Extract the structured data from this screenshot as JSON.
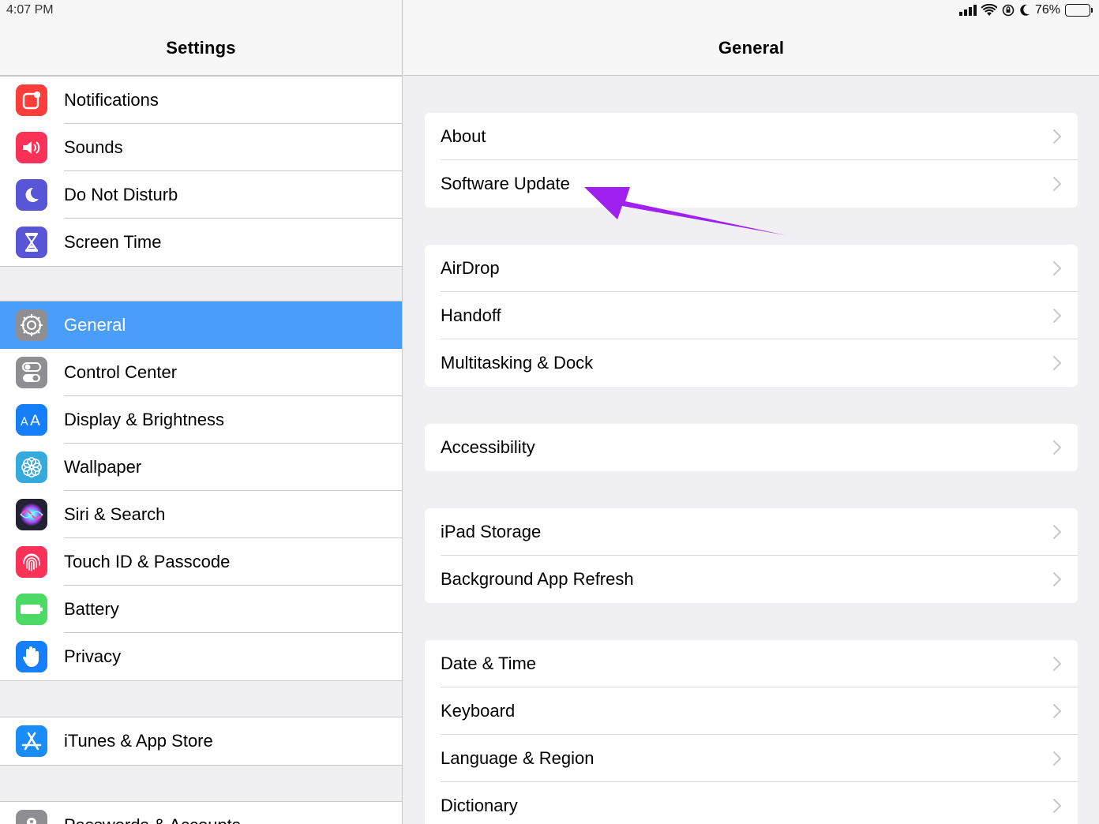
{
  "status_bar": {
    "time": "4:07 PM",
    "battery_percent": "76%",
    "battery_level": 0.76
  },
  "sidebar": {
    "title": "Settings",
    "groups": [
      {
        "items": [
          {
            "label": "Notifications",
            "icon": "notifications-icon",
            "color": "#fc3d39"
          },
          {
            "label": "Sounds",
            "icon": "speaker-icon",
            "color": "#fc3158"
          },
          {
            "label": "Do Not Disturb",
            "icon": "moon-icon",
            "color": "#5856d6"
          },
          {
            "label": "Screen Time",
            "icon": "hourglass-icon",
            "color": "#5856d6"
          }
        ]
      },
      {
        "items": [
          {
            "label": "General",
            "icon": "gear-icon",
            "color": "#8e8e93",
            "selected": true
          },
          {
            "label": "Control Center",
            "icon": "toggles-icon",
            "color": "#8e8e93"
          },
          {
            "label": "Display & Brightness",
            "icon": "text-size-icon",
            "color": "#147efb"
          },
          {
            "label": "Wallpaper",
            "icon": "flower-icon",
            "color": "#35aadc"
          },
          {
            "label": "Siri & Search",
            "icon": "siri-icon",
            "color": "#222233"
          },
          {
            "label": "Touch ID & Passcode",
            "icon": "fingerprint-icon",
            "color": "#fc3158"
          },
          {
            "label": "Battery",
            "icon": "battery-icon",
            "color": "#4cd964"
          },
          {
            "label": "Privacy",
            "icon": "hand-icon",
            "color": "#147efb"
          }
        ]
      },
      {
        "items": [
          {
            "label": "iTunes & App Store",
            "icon": "app-store-icon",
            "color": "#1a8cf5"
          }
        ]
      },
      {
        "items": [
          {
            "label": "Passwords & Accounts",
            "icon": "key-icon",
            "color": "#8e8e93"
          }
        ]
      }
    ]
  },
  "content": {
    "title": "General",
    "groups": [
      {
        "items": [
          "About",
          "Software Update"
        ]
      },
      {
        "items": [
          "AirDrop",
          "Handoff",
          "Multitasking & Dock"
        ]
      },
      {
        "items": [
          "Accessibility"
        ]
      },
      {
        "items": [
          "iPad Storage",
          "Background App Refresh"
        ]
      },
      {
        "items": [
          "Date & Time",
          "Keyboard",
          "Language & Region",
          "Dictionary"
        ]
      }
    ]
  },
  "annotation": {
    "color": "#a020f0"
  }
}
